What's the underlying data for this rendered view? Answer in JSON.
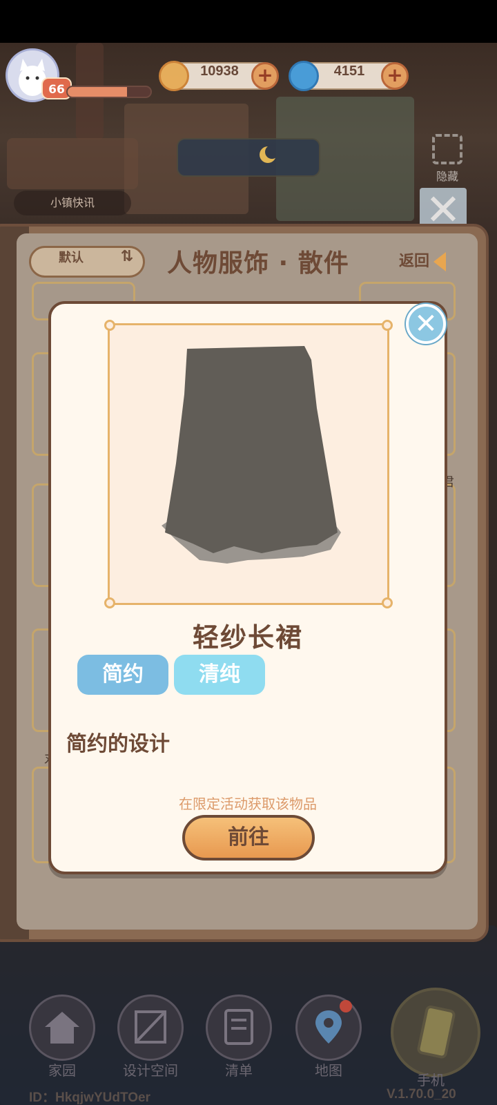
{
  "player": {
    "level": "66",
    "xp_fraction": 0.72
  },
  "currencies": [
    {
      "name": "coin",
      "icon": "coin-icon",
      "value": "10938"
    },
    {
      "name": "swirl-gem",
      "icon": "swirl-icon",
      "value": "4151"
    }
  ],
  "hud": {
    "news_label": "小镇快讯",
    "hide_label": "隐藏"
  },
  "panel": {
    "sort_label": "默认",
    "sort_icon": "⇅",
    "title": "人物服饰 · 散件",
    "back_label": "返回",
    "slot_labels": [
      "君",
      "丸"
    ]
  },
  "item": {
    "name": "轻纱长裙",
    "tags": [
      {
        "label": "简约",
        "color": "#7cbde2"
      },
      {
        "label": "清纯",
        "color": "#8fdcf0"
      }
    ],
    "description": "简约的设计",
    "source": "在限定活动获取该物品",
    "go_label": "前往",
    "skirt_color": "#615d57",
    "hem_color": "#9a958f"
  },
  "nav": {
    "items": [
      {
        "label": "家园",
        "icon": "home-icon"
      },
      {
        "label": "设计空间",
        "icon": "design-space-icon"
      },
      {
        "label": "清单",
        "icon": "checklist-icon"
      },
      {
        "label": "地图",
        "icon": "map-pin-icon"
      }
    ],
    "phone_label": "手机"
  },
  "footer": {
    "player_id": "ID：HkqjwYUdTOer",
    "version": "V.1.70.0_20"
  },
  "colors": {
    "accent_orange": "#e89950",
    "brown_text": "#6e4a36",
    "close_blue": "#8cc7e2"
  }
}
